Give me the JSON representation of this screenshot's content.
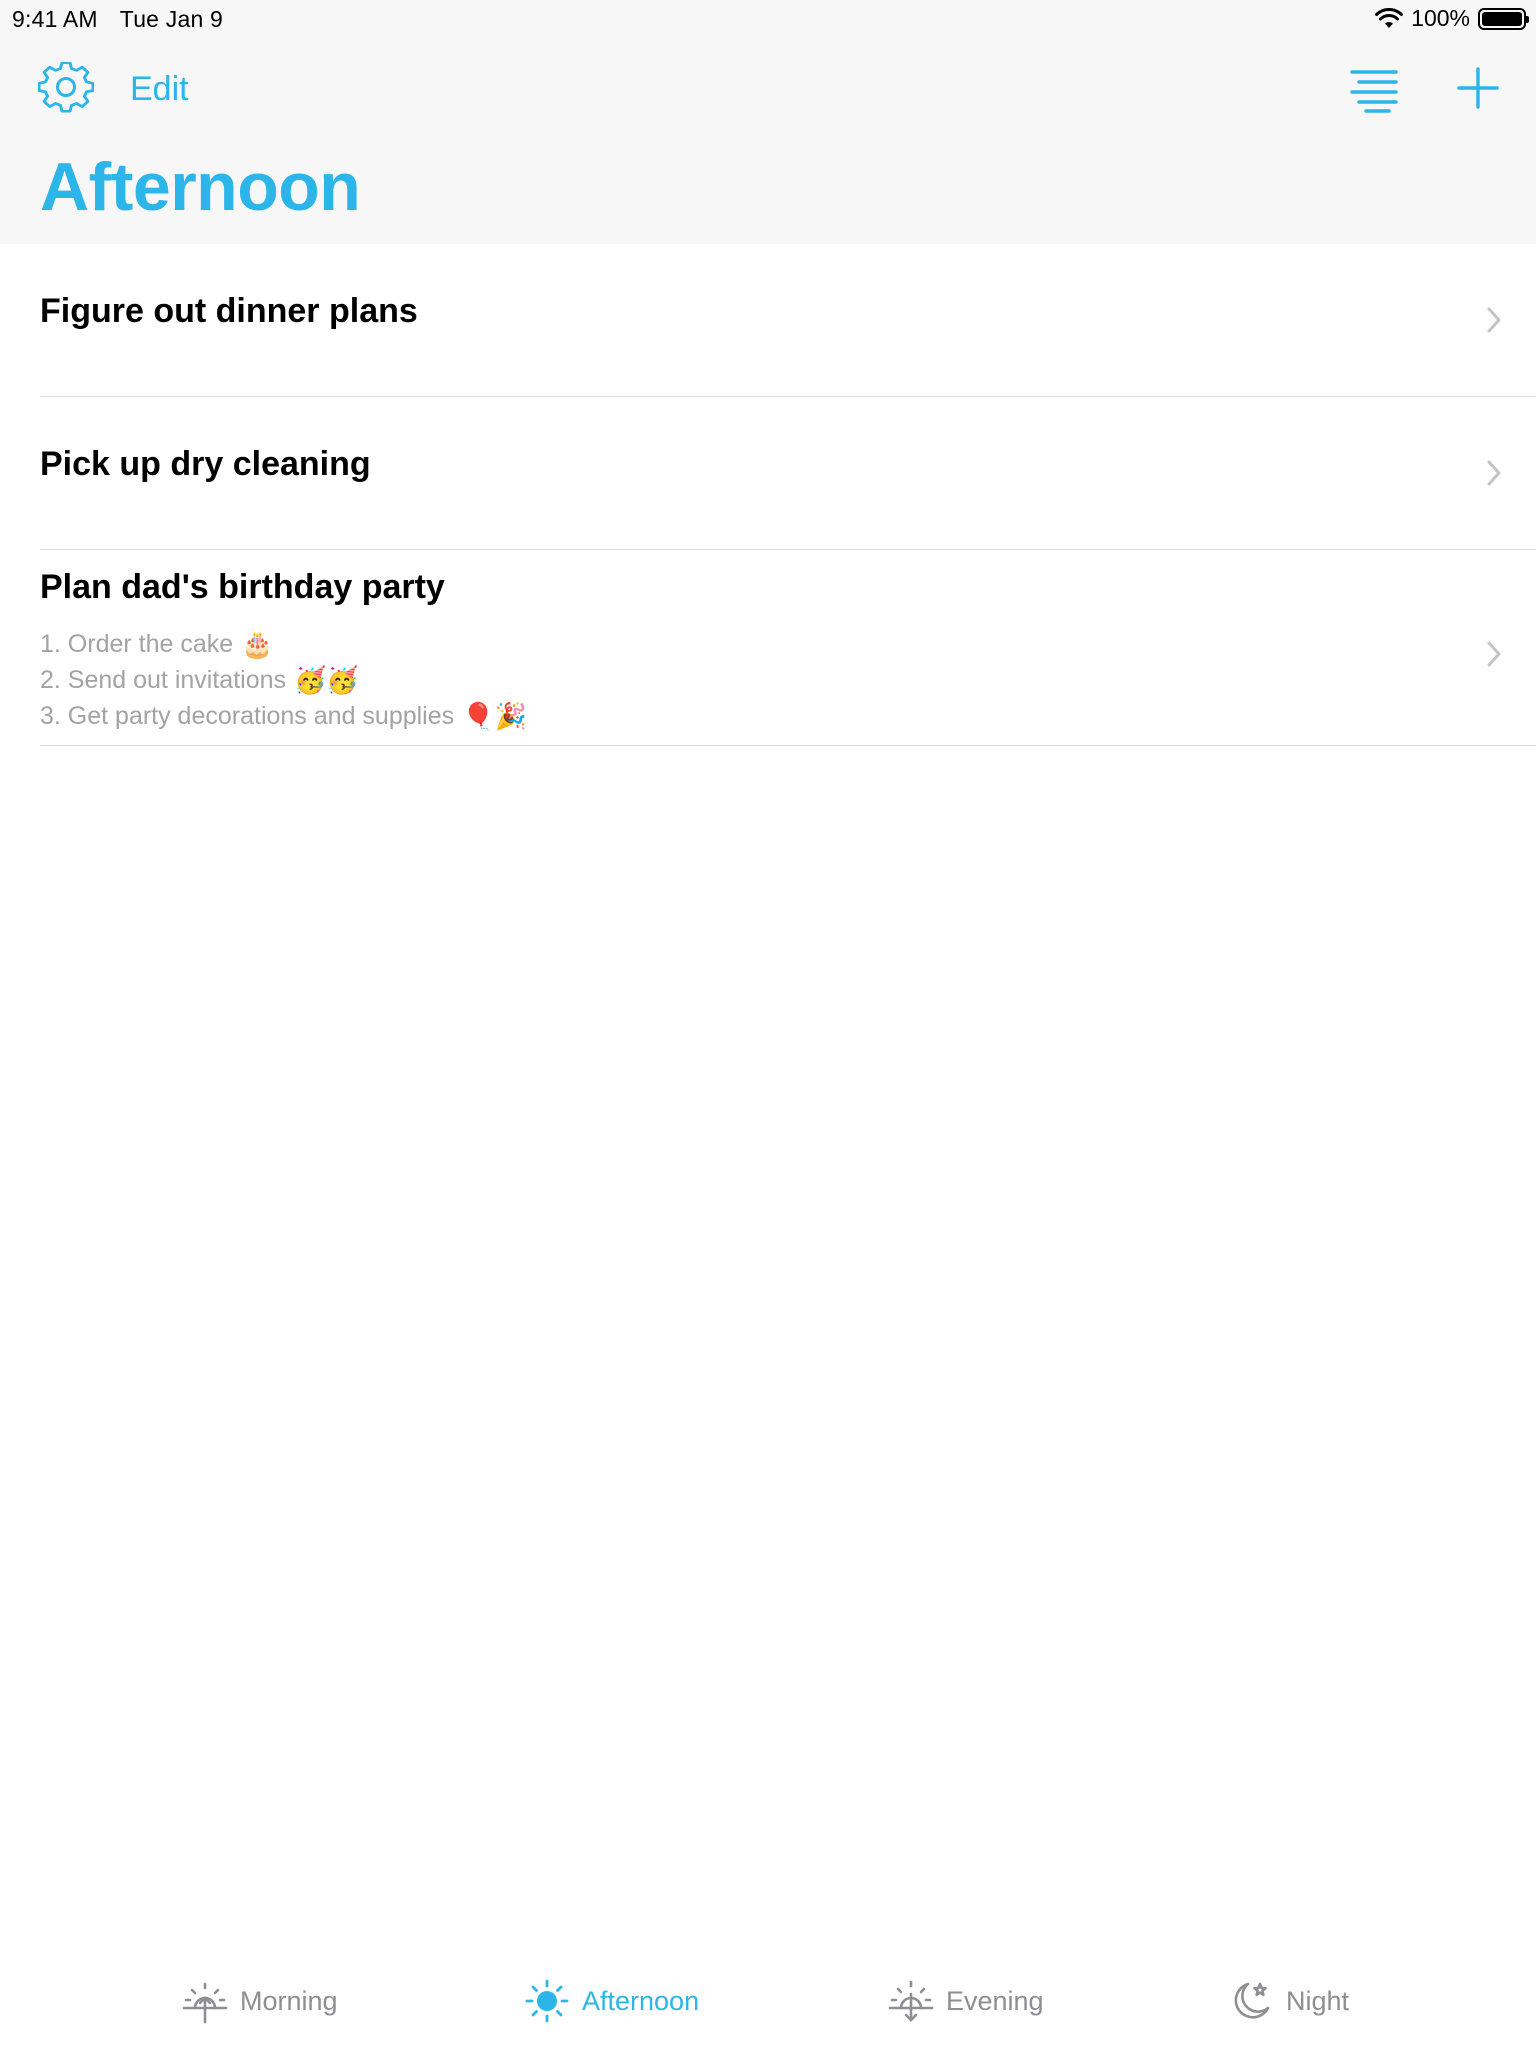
{
  "status_bar": {
    "time": "9:41 AM",
    "date": "Tue Jan 9",
    "battery": "100%",
    "battery_level": 1.0,
    "icons": [
      "wifi-icon",
      "battery-icon"
    ]
  },
  "nav": {
    "settings_icon": "gear-icon",
    "edit_label": "Edit",
    "list_icon": "list-icon",
    "add_icon": "plus-icon",
    "title": "Afternoon"
  },
  "tasks": [
    {
      "title": "Figure out dinner plans"
    },
    {
      "title": "Pick up dry cleaning"
    },
    {
      "title": "Plan dad's birthday party",
      "notes": [
        {
          "text": "1. Order the cake",
          "emoji": "🎂"
        },
        {
          "text": "2. Send out invitations",
          "emoji": "🥳🥳"
        },
        {
          "text": "3. Get party decorations and supplies",
          "emoji": "🎈🎉"
        }
      ]
    }
  ],
  "tabs": [
    {
      "label": "Morning",
      "icon": "sunrise-icon",
      "active": false
    },
    {
      "label": "Afternoon",
      "icon": "sun-icon",
      "active": true
    },
    {
      "label": "Evening",
      "icon": "sunset-icon",
      "active": false
    },
    {
      "label": "Night",
      "icon": "moon-icon",
      "active": false
    }
  ],
  "colors": {
    "accent": "#2bb5e8",
    "inactive": "#8e8e93",
    "note_text": "#a3a3a3"
  }
}
